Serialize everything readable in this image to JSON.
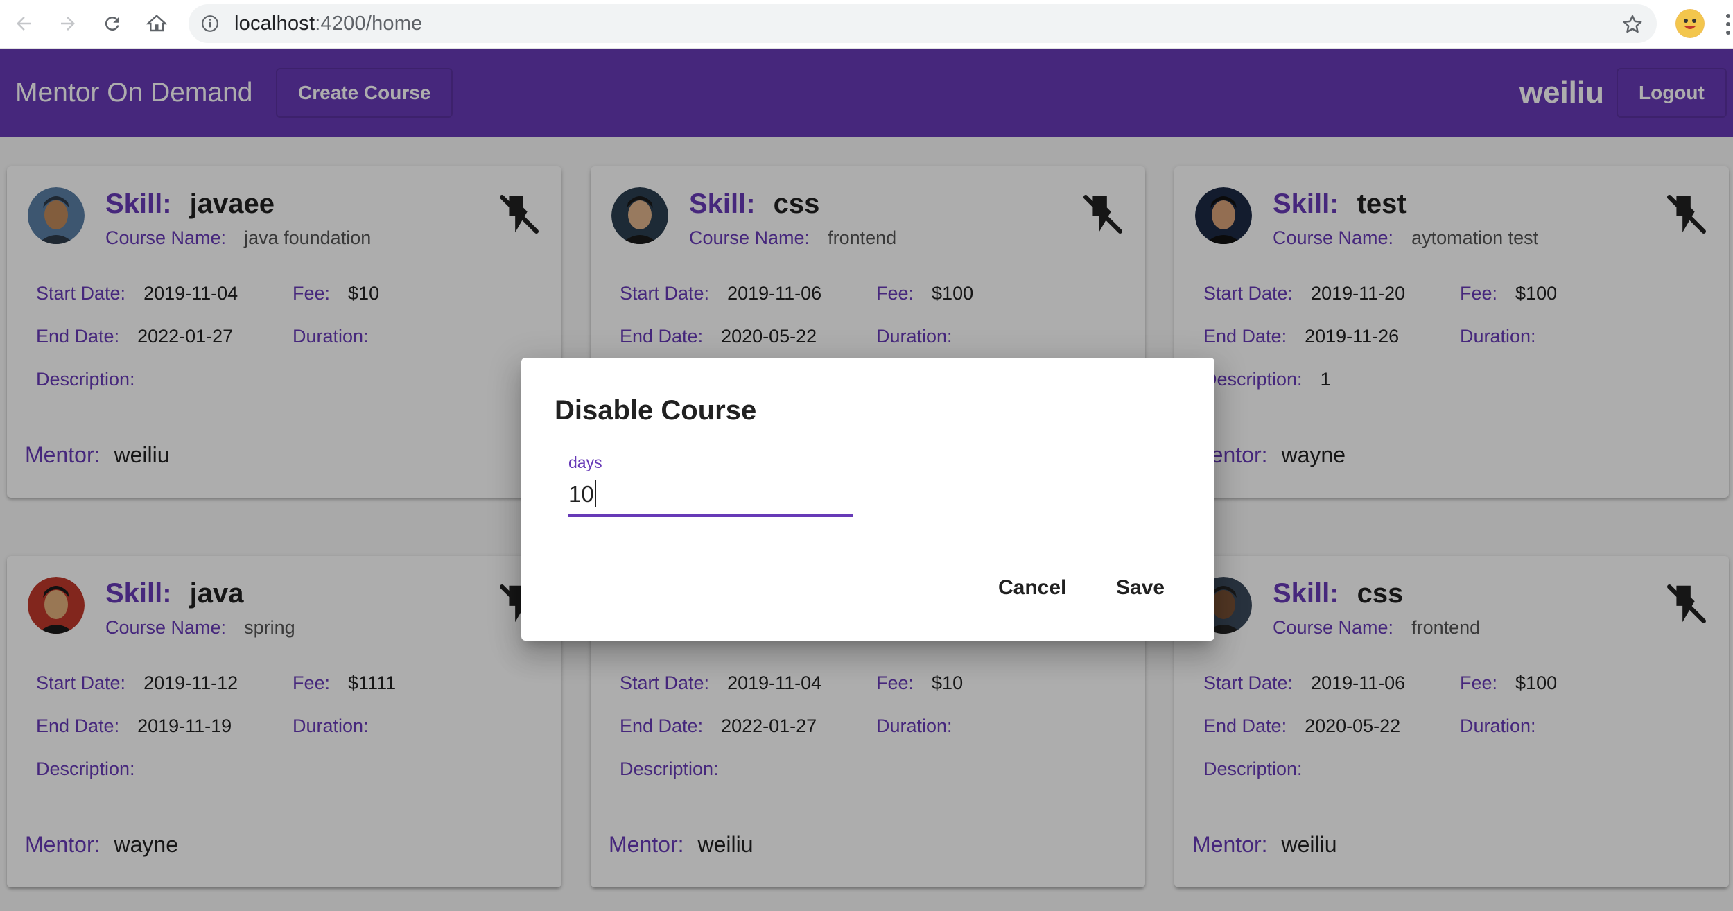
{
  "browser": {
    "url_host": "localhost",
    "url_rest": ":4200/home"
  },
  "toolbar": {
    "app_title": "Mentor On Demand",
    "create_course_label": "Create Course",
    "username": "weiliu",
    "logout_label": "Logout",
    "color": "#673ab7"
  },
  "labels": {
    "skill": "Skill:",
    "course_name": "Course Name:",
    "start_date": "Start Date:",
    "end_date": "End Date:",
    "fee": "Fee:",
    "duration": "Duration:",
    "description": "Description:",
    "mentor": "Mentor:"
  },
  "courses": [
    {
      "skill": "javaee",
      "course_name": "java foundation",
      "start_date": "2019-11-04",
      "end_date": "2022-01-27",
      "fee": "$10",
      "duration": "",
      "description": "",
      "mentor": "weiliu",
      "avatar": "avatar-hero-1",
      "status_icon": "flash-off-icon"
    },
    {
      "skill": "css",
      "course_name": "frontend",
      "start_date": "2019-11-06",
      "end_date": "2020-05-22",
      "fee": "$100",
      "duration": "",
      "description": "",
      "mentor": "",
      "avatar": "avatar-hero-2",
      "status_icon": "flash-off-icon"
    },
    {
      "skill": "test",
      "course_name": "aytomation test",
      "start_date": "2019-11-20",
      "end_date": "2019-11-26",
      "fee": "$100",
      "duration": "",
      "description": "1",
      "mentor": "wayne",
      "avatar": "avatar-hero-3",
      "status_icon": "flash-off-icon"
    },
    {
      "skill": "java",
      "course_name": "spring",
      "start_date": "2019-11-12",
      "end_date": "2019-11-19",
      "fee": "$1111",
      "duration": "",
      "description": "",
      "mentor": "wayne",
      "avatar": "avatar-hero-4",
      "status_icon": "flash-off-icon"
    },
    {
      "skill": "",
      "course_name": "",
      "start_date": "2019-11-04",
      "end_date": "2022-01-27",
      "fee": "$10",
      "duration": "",
      "description": "",
      "mentor": "weiliu",
      "avatar": "",
      "status_icon": ""
    },
    {
      "skill": "css",
      "course_name": "frontend",
      "start_date": "2019-11-06",
      "end_date": "2020-05-22",
      "fee": "$100",
      "duration": "",
      "description": "",
      "mentor": "weiliu",
      "avatar": "avatar-hero-5",
      "status_icon": "flash-off-icon"
    }
  ],
  "dialog": {
    "title": "Disable Course",
    "field_label": "days",
    "field_value": "10",
    "cancel_label": "Cancel",
    "save_label": "Save"
  }
}
